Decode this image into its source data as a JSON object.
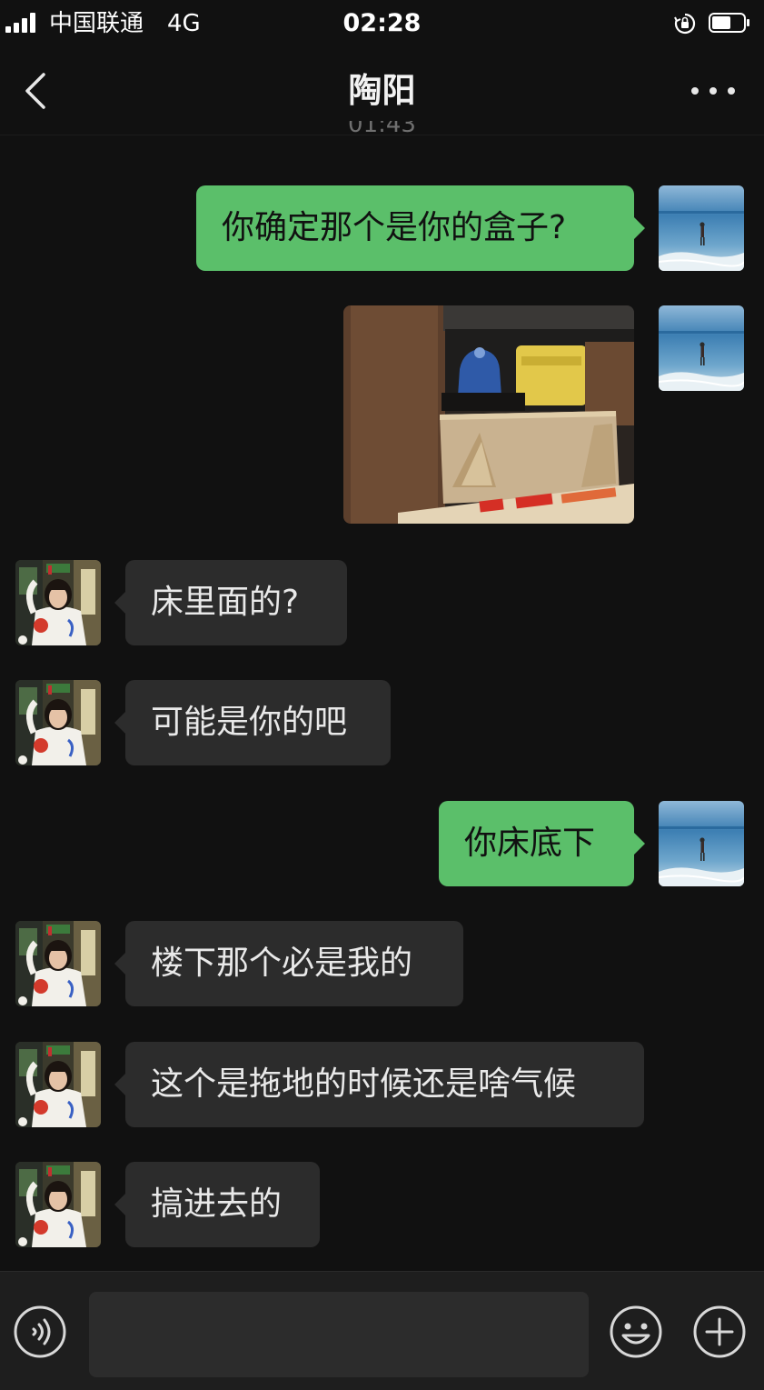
{
  "status_bar": {
    "carrier": "中国联通",
    "network": "4G",
    "time": "02:28"
  },
  "nav": {
    "title": "陶阳",
    "partial_timestamp": "01:43"
  },
  "messages": [
    {
      "from": "me",
      "text": "你确定那个是你的盒子?"
    },
    {
      "from": "me",
      "type": "image",
      "icon": "photo-of-cardboard-box-in-cabinet"
    },
    {
      "from": "them",
      "text": "床里面的?"
    },
    {
      "from": "them",
      "text": "可能是你的吧"
    },
    {
      "from": "me",
      "text": "你床底下"
    },
    {
      "from": "them",
      "text": "楼下那个必是我的"
    },
    {
      "from": "them",
      "text": "这个是拖地的时候还是啥气候"
    },
    {
      "from": "them",
      "text": "搞进去的"
    }
  ],
  "input_bar": {
    "voice_icon": "voice-icon",
    "emoji_icon": "emoji-icon",
    "plus_icon": "plus-icon",
    "input_value": ""
  },
  "colors": {
    "background": "#111111",
    "my_bubble": "#5bbf6a",
    "their_bubble": "#2c2c2c",
    "input_bar": "#1e1e1e"
  }
}
